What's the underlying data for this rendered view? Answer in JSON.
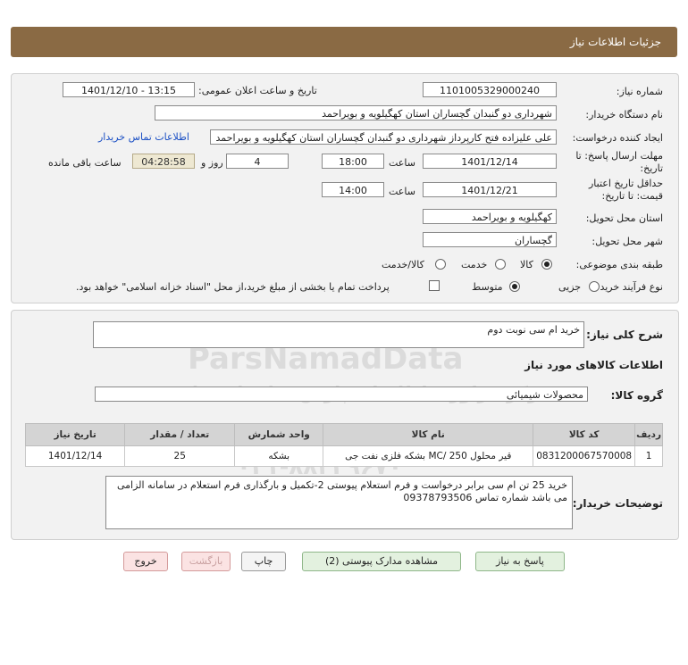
{
  "header": {
    "title": "جزئیات اطلاعات نیاز"
  },
  "form": {
    "need_number_label": "شماره نیاز:",
    "need_number": "1101005329000240",
    "announce_label": "تاریخ و ساعت اعلان عمومی:",
    "announce_value": "1401/12/10 - 13:15",
    "buyer_org_label": "نام دستگاه خریدار:",
    "buyer_org": "شهرداری دو گنبدان گچساران استان کهگیلویه و بویراحمد",
    "creator_label": "ایجاد کننده درخواست:",
    "creator": "علی علیزاده فتح کارپرداز شهرداری دو گنبدان گچساران استان کهگیلویه و بویراحمد",
    "contact_link": "اطلاعات تماس خریدار",
    "reply_deadline_label": "مهلت ارسال پاسخ: تا تاریخ:",
    "reply_date": "1401/12/14",
    "time_label": "ساعت",
    "reply_time": "18:00",
    "days_value": "4",
    "days_label": "روز و",
    "remaining_time": "04:28:58",
    "remaining_label": "ساعت باقی مانده",
    "price_validity_label": "حداقل تاریخ اعتبار قیمت: تا تاریخ:",
    "price_date": "1401/12/21",
    "price_time": "14:00",
    "delivery_province_label": "استان محل تحویل:",
    "delivery_province": "کهگیلویه و بویراحمد",
    "delivery_city_label": "شهر محل تحویل:",
    "delivery_city": "گچساران",
    "category_label": "طبقه بندی موضوعی:",
    "category_options": [
      "کالا",
      "خدمت",
      "کالا/خدمت"
    ],
    "category_selected": "کالا",
    "process_label": "نوع فرآیند خرید :",
    "process_options": [
      "جزیی",
      "متوسط"
    ],
    "process_selected": "متوسط",
    "payment_note": "پرداخت تمام یا بخشی از مبلغ خرید،از محل \"اسناد خزانه اسلامی\" خواهد بود."
  },
  "details": {
    "summary_label": "شرح کلی نیاز:",
    "summary": "خرید ام سی نوبت دوم",
    "goods_info_title": "اطلاعات کالاهای مورد نیاز",
    "goods_group_label": "گروه کالا:",
    "goods_group": "محصولات شیمیائی",
    "table": {
      "headers": [
        "ردیف",
        "کد کالا",
        "نام کالا",
        "واحد شمارش",
        "تعداد / مقدار",
        "تاریخ نیاز"
      ],
      "rows": [
        [
          "1",
          "0831200067570008",
          "قیر محلول MC/ 250 بشکه فلزی نفت جی",
          "بشکه",
          "25",
          "1401/12/14"
        ]
      ]
    },
    "buyer_notes_label": "توضیحات خریدار:",
    "buyer_notes": "خرید 25 تن  ام سی  برابر درخواست  و فرم استعلام  پیوستی 2-تکمیل و بارگذاری  فرم استعلام در سامانه الزامی می باشد شماره تماس 09378793506"
  },
  "buttons": {
    "reply": "پاسخ به نیاز",
    "attachments": "مشاهده مدارک پیوستی (2)",
    "print": "چاپ",
    "back": "بازگشت",
    "exit": "خروج"
  },
  "watermark": {
    "brand": "ParsNamadData",
    "line1": "مرکز فراوری اطلاعات پارس نماد داده ها",
    "line2": "پایگاه خبری اطلاع رسانی مناقصه و مزایده",
    "phone": "۰۲۱-۸۸۳۴۹۶۷۰"
  }
}
